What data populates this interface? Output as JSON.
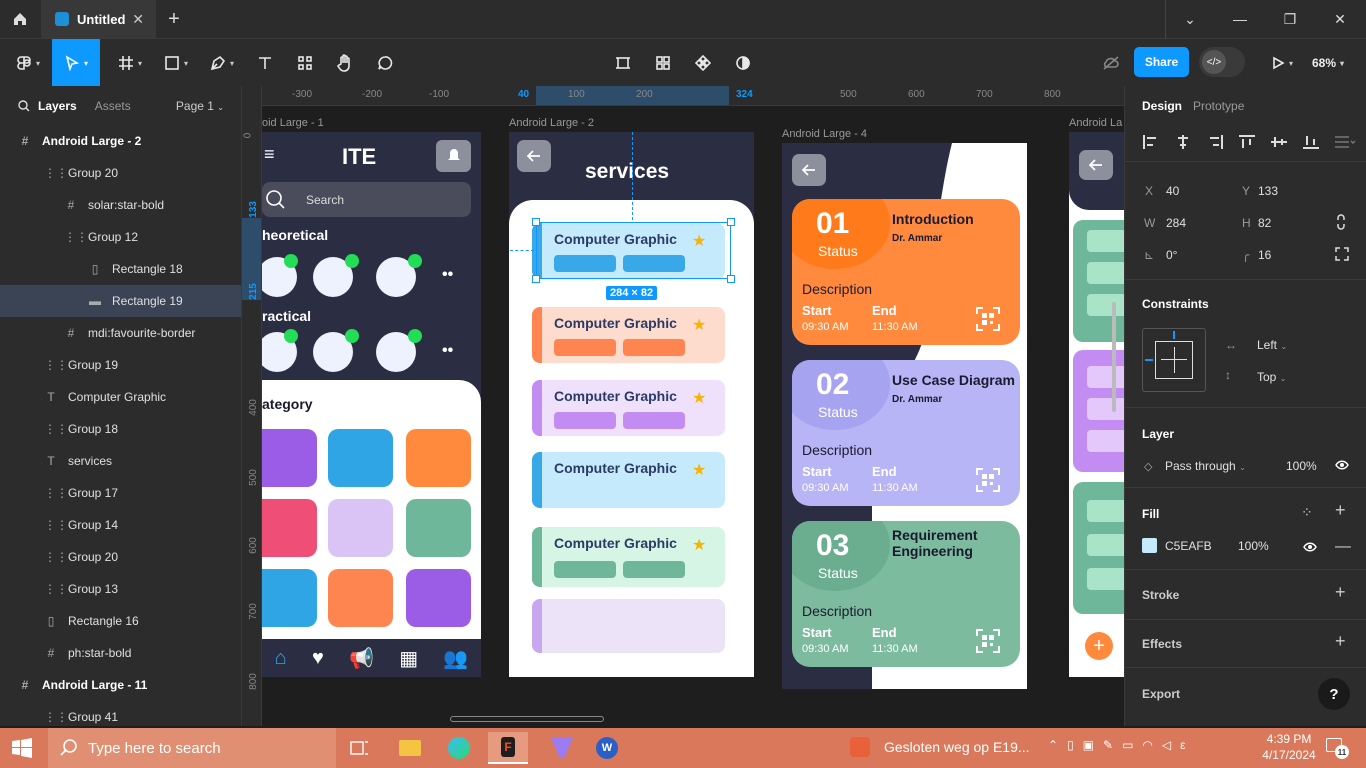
{
  "titlebar": {
    "tab_title": "Untitled",
    "close": "✕",
    "new_tab": "+"
  },
  "toolbar": {
    "share_label": "Share",
    "zoom": "68%"
  },
  "left_panel": {
    "tab_layers": "Layers",
    "tab_assets": "Assets",
    "page": "Page 1",
    "layers": [
      {
        "name": "Android Large - 2",
        "icon": "#",
        "indent": 0,
        "bold": true
      },
      {
        "name": "Group 20",
        "icon": "⋮⋮",
        "indent": 1
      },
      {
        "name": "solar:star-bold",
        "icon": "#",
        "indent": 2
      },
      {
        "name": "Group 12",
        "icon": "⋮⋮",
        "indent": 2
      },
      {
        "name": "Rectangle 18",
        "icon": "▯",
        "indent": 3
      },
      {
        "name": "Rectangle 19",
        "icon": "▬",
        "indent": 3,
        "selected": true
      },
      {
        "name": "mdi:favourite-border",
        "icon": "#",
        "indent": 2
      },
      {
        "name": "Group 19",
        "icon": "⋮⋮",
        "indent": 1
      },
      {
        "name": "Computer Graphic",
        "icon": "T",
        "indent": 1
      },
      {
        "name": "Group 18",
        "icon": "⋮⋮",
        "indent": 1
      },
      {
        "name": "services",
        "icon": "T",
        "indent": 1
      },
      {
        "name": "Group 17",
        "icon": "⋮⋮",
        "indent": 1
      },
      {
        "name": "Group 14",
        "icon": "⋮⋮",
        "indent": 1
      },
      {
        "name": "Group 20",
        "icon": "⋮⋮",
        "indent": 1
      },
      {
        "name": "Group 13",
        "icon": "⋮⋮",
        "indent": 1
      },
      {
        "name": "Rectangle 16",
        "icon": "▯",
        "indent": 1
      },
      {
        "name": "ph:star-bold",
        "icon": "#",
        "indent": 1
      },
      {
        "name": "Android Large - 11",
        "icon": "#",
        "indent": 0,
        "bold": true
      },
      {
        "name": "Group 41",
        "icon": "⋮⋮",
        "indent": 1
      }
    ]
  },
  "rulers": {
    "top": [
      "-300",
      "-200",
      "-100",
      "40",
      "100",
      "200",
      "324",
      "500",
      "600",
      "700",
      "800"
    ],
    "top_highlight": [
      "40",
      "324"
    ],
    "left": [
      "0",
      "133",
      "215",
      "400",
      "500",
      "600",
      "700",
      "800"
    ],
    "left_highlight": [
      "133",
      "215"
    ]
  },
  "canvas": {
    "frame1_label": "oid Large - 1",
    "frame2_label": "Android Large - 2",
    "frame4_label": "Android Large - 4",
    "frame5_label": "Android La",
    "frame1": {
      "title": "ITE",
      "search_placeholder": "Search",
      "section1": "heoretical",
      "section2": "ractical",
      "section3": "ategory",
      "more": "••"
    },
    "frame2": {
      "title": "services",
      "size_badge": "284 × 82",
      "card_title": "Computer Graphic"
    },
    "frame4": {
      "cards": [
        {
          "num": "01",
          "status": "Status",
          "title": "Introduction",
          "subtitle": "Dr. Ammar",
          "desc": "Description",
          "start": "Start",
          "end": "End",
          "start_time": "09:30 AM",
          "end_time": "11:30 AM",
          "color": "#ff8a3d",
          "blob": "#ff7a1a"
        },
        {
          "num": "02",
          "status": "Status",
          "title": "Use Case Diagram",
          "subtitle": "Dr. Ammar",
          "desc": "Description",
          "start": "Start",
          "end": "End",
          "start_time": "09:30 AM",
          "end_time": "11:30 AM",
          "color": "#b7b5f5",
          "blob": "#a6a3f0"
        },
        {
          "num": "03",
          "status": "Status",
          "title_line1": "Requirement",
          "title_line2": "Engineering",
          "desc": "Description",
          "start": "Start",
          "end": "End",
          "start_time": "09:30 AM",
          "end_time": "11:30 AM",
          "color": "#7dbb9f",
          "blob": "#6aae8f"
        }
      ]
    }
  },
  "right_panel": {
    "tab_design": "Design",
    "tab_prototype": "Prototype",
    "x_label": "X",
    "x": "40",
    "y_label": "Y",
    "y": "133",
    "w_label": "W",
    "w": "284",
    "h_label": "H",
    "h": "82",
    "rotation": "0°",
    "radius": "16",
    "constraints": "Constraints",
    "constraint_h": "Left",
    "constraint_v": "Top",
    "layer": "Layer",
    "blend": "Pass through",
    "opacity": "100%",
    "fill": "Fill",
    "fill_hex": "C5EAFB",
    "fill_color": "#c5eafb",
    "fill_opacity": "100%",
    "stroke": "Stroke",
    "effects": "Effects",
    "export": "Export",
    "help": "?"
  },
  "taskbar": {
    "search_placeholder": "Type here to search",
    "news": "Gesloten weg op E19...",
    "lang": "ε",
    "time": "4:39 PM",
    "date": "4/17/2024",
    "notif": "11"
  }
}
